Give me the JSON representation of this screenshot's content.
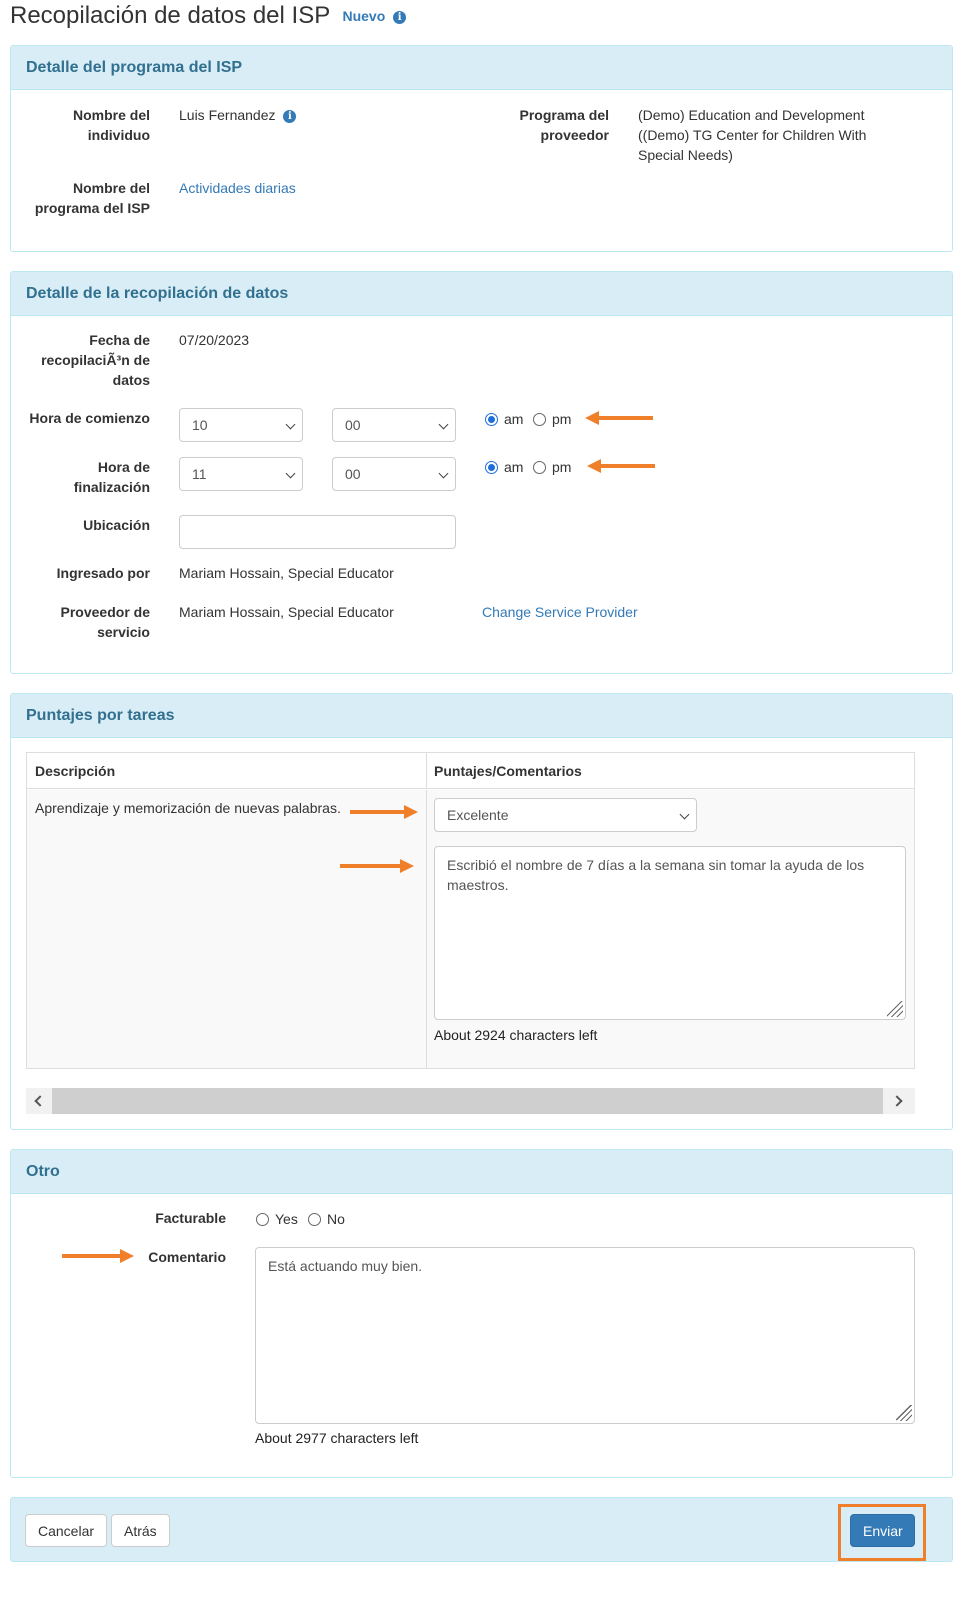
{
  "page": {
    "title": "Recopilación de datos del ISP",
    "badge": "Nuevo"
  },
  "isp_detail": {
    "heading": "Detalle del programa del ISP",
    "individual_label": "Nombre del individuo",
    "individual_value": "Luis Fernandez",
    "provider_program_label": "Programa del proveedor",
    "provider_program_value": "(Demo) Education and Development ((Demo) TG Center for Children With Special Needs)",
    "isp_program_label": "Nombre del programa del ISP",
    "isp_program_value": "Actividades diarias"
  },
  "collection_detail": {
    "heading": "Detalle de la recopilación de datos",
    "date_label": "Fecha de recopilaciÃ³n de datos",
    "date_value": "07/20/2023",
    "start_label": "Hora de comienzo",
    "start_hour": "10",
    "start_minute": "00",
    "end_label": "Hora de finalización",
    "end_hour": "11",
    "end_minute": "00",
    "am_label": "am",
    "pm_label": "pm",
    "location_label": "Ubicación",
    "location_value": "",
    "entered_by_label": "Ingresado por",
    "entered_by_value": "Mariam Hossain, Special Educator",
    "provider_label": "Proveedor de servicio",
    "provider_value": "Mariam Hossain, Special Educator",
    "change_provider_link": "Change Service Provider"
  },
  "task_scores": {
    "heading": "Puntajes por tareas",
    "col_description": "Descripción",
    "col_scores": "Puntajes/Comentarios",
    "rows": [
      {
        "description": "Aprendizaje y memorización de nuevas palabras.",
        "score": "Excelente",
        "comment": "Escribió el nombre de 7 días a la semana sin tomar la ayuda de los maestros.",
        "chars_left": "About 2924 characters left"
      }
    ]
  },
  "other": {
    "heading": "Otro",
    "billable_label": "Facturable",
    "yes_label": "Yes",
    "no_label": "No",
    "comment_label": "Comentario",
    "comment_value": "Está actuando muy bien.",
    "chars_left": "About 2977 characters left"
  },
  "footer": {
    "cancel": "Cancelar",
    "back": "Atrás",
    "submit": "Enviar"
  },
  "colors": {
    "accent": "#337ab7",
    "panel_header": "#d9edf7",
    "highlight": "#f07f2a"
  }
}
